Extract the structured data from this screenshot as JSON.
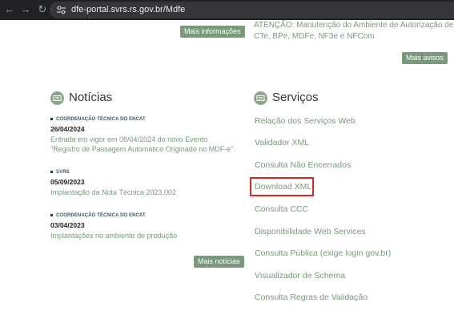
{
  "browser": {
    "url": "dfe-portal.svrs.rs.gov.br/Mdfe",
    "icons": {
      "back": "arrow-left-icon",
      "forward": "arrow-right-icon",
      "reload": "reload-icon",
      "site_info": "tune-icon"
    }
  },
  "top": {
    "mais_informacoes": "Mais informações",
    "attention_line1": "ATENÇÃO: Manutenção do Ambiente de Autorização de",
    "attention_line2": "CTe, BPe, MDFe, NF3e e NFCom",
    "mais_avisos": "Mais avisos"
  },
  "noticias": {
    "title": "Notícias",
    "icon": "newspaper-icon",
    "items": [
      {
        "source": "COORDENAÇÃO TÉCNICA DO ENCAT",
        "date": "26/04/2024",
        "title_line1": "Entrada em vigor em 08/04/2024 do novo Evento",
        "title_line2": "\"Registro de Passagem Automático Originado no MDF-e\"."
      },
      {
        "source": "SVRS",
        "date": "05/09/2023",
        "title_line1": "Implantação da Nota Técnica 2023.002",
        "title_line2": ""
      },
      {
        "source": "COORDENAÇÃO TÉCNICA DO ENCAT",
        "date": "03/04/2023",
        "title_line1": "Implantações no ambiente de produção",
        "title_line2": ""
      }
    ],
    "mais_noticias": "Mais notícias"
  },
  "servicos": {
    "title": "Serviços",
    "icon": "list-icon",
    "items": [
      "Relação dos Serviços Web",
      "Validador XML",
      "Consulta Não Encerrados",
      "Download XML",
      "Consulta CCC",
      "Disponibilidade Web Services",
      "Consulta Pública (exige login gov.br)",
      "Visualizador de Schema",
      "Consulta Regras de Validação"
    ],
    "highlighted": "Download XML",
    "highlight_color": "#e0231f"
  },
  "colors": {
    "accent": "#7a987a",
    "source_blue": "#2f5f7a",
    "browser_bar": "#202124"
  }
}
